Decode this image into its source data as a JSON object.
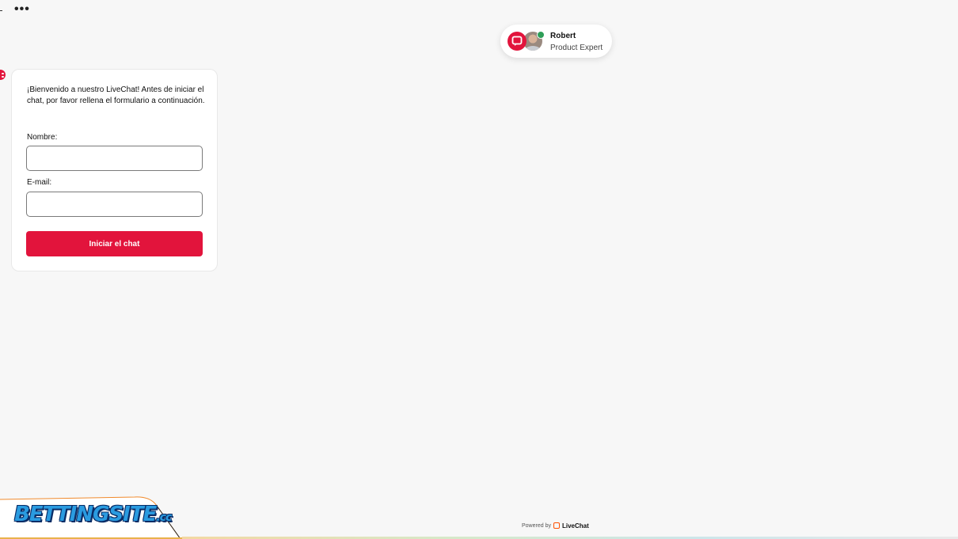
{
  "header": {
    "more_label": "•••"
  },
  "agent": {
    "name": "Robert",
    "role": "Product Expert",
    "status_color": "#2e9e58"
  },
  "form": {
    "welcome": "¡Bienvenido a nuestro LiveChat! Antes de iniciar el chat, por favor rellena el formulario a continuación.",
    "name_label": "Nombre:",
    "name_value": "",
    "email_label": "E-mail:",
    "email_value": "",
    "submit_label": "Iniciar el chat"
  },
  "branding": {
    "logo_text": "BETTINGSITE",
    "logo_suffix": ".cc",
    "powered_by": "Powered by",
    "powered_brand": "LiveChat"
  },
  "colors": {
    "accent": "#e2143c",
    "background": "#f7f7f7"
  },
  "icons": {
    "chat_badge": "chat-bubble-icon",
    "livechat_logo": "livechat-logo-icon"
  }
}
